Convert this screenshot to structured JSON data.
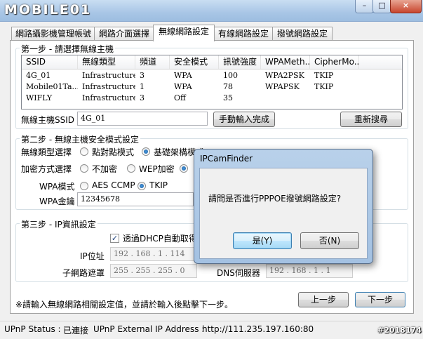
{
  "window": {
    "logo": "MOBILE01",
    "min": "–",
    "max": "□",
    "close": "×"
  },
  "tabs": [
    "網路攝影機管理帳號",
    "網路介面選擇",
    "無線網路設定",
    "有線網路設定",
    "撥號網路設定"
  ],
  "step1": {
    "title": "第一步 - 請選擇無線主機",
    "columns": [
      "SSID",
      "無線類型",
      "頻道",
      "安全模式",
      "訊號強度",
      "WPAMeth...",
      "CipherMo..."
    ],
    "rows": [
      [
        "4G_01",
        "Infrastructure",
        "3",
        "WPA",
        "100",
        "WPA2PSK",
        "TKIP"
      ],
      [
        "Mobile01Ta...",
        "Infrastructure",
        "1",
        "WPA",
        "78",
        "WPAPSK",
        "TKIP"
      ],
      [
        "WIFLY",
        "Infrastructure",
        "3",
        "Off",
        "35",
        "",
        ""
      ]
    ],
    "ssid_label": "無線主機SSID",
    "ssid_value": "4G_01",
    "manual_button": "手動輸入完成",
    "rescan_button": "重新搜尋"
  },
  "step2": {
    "title": "第二步 - 無線主機安全模式設定",
    "type_label": "無線類型選擇",
    "type_adhoc": "點對點模式",
    "type_infra": "基礎架構模式",
    "enc_label": "加密方式選擇",
    "enc_none": "不加密",
    "enc_wep": "WEP加密",
    "wpa_mode_label": "WPA模式",
    "wpa_aes": "AES CCMP",
    "wpa_tkip": "TKIP",
    "wpa_key_label": "WPA金鑰",
    "wpa_key_value": "12345678"
  },
  "step3": {
    "title": "第三步 - IP資訊設定",
    "dhcp_label": "透過DHCP自動取得",
    "ip_label": "IP位址",
    "ip_value": "192 . 168 .  1  . 114",
    "mask_label": "子網路遮罩",
    "mask_value": "255 . 255 . 255 .  0",
    "dns_label": "DNS伺服器",
    "dns_value": "192 . 168 .  1  .  1"
  },
  "footer": {
    "note": "※請輸入無線網路相關設定值，並請於輸入後點擊下一步。",
    "prev_button": "上一步",
    "next_button": "下一步"
  },
  "statusbar": {
    "upnp_status_label": "UPnP Status :",
    "upnp_status_value": "已連接",
    "upnp_ip_label": "UPnP External IP Address :",
    "upnp_ip_value": "http://111.235.197.160:80",
    "watermark": "#2018174"
  },
  "dialog": {
    "title": "IPCamFinder",
    "message": "請問是否進行PPPOE撥號網路設定?",
    "yes_button": "是(Y)",
    "no_button": "否(N)"
  }
}
